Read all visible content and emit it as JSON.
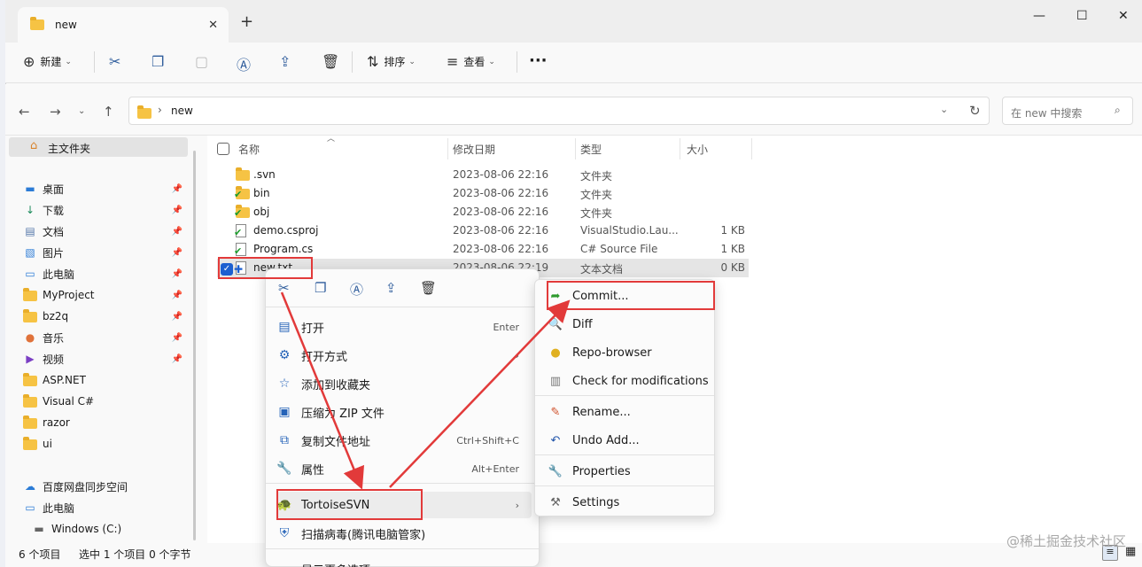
{
  "tab": {
    "title": "new",
    "close": "✕",
    "new": "+"
  },
  "window_controls": {
    "minimize": "—",
    "maximize": "☐",
    "close": "✕"
  },
  "toolbar": {
    "new_label": "新建",
    "sort_label": "排序",
    "view_label": "查看",
    "more": "···"
  },
  "address": {
    "folder": "new",
    "sep": "›",
    "search_placeholder": "在 new 中搜索"
  },
  "sidebar": {
    "home": "主文件夹",
    "items": [
      {
        "label": "桌面",
        "icon": "desktop-icon",
        "pinned": true
      },
      {
        "label": "下载",
        "icon": "download-icon",
        "pinned": true
      },
      {
        "label": "文档",
        "icon": "document-icon",
        "pinned": true
      },
      {
        "label": "图片",
        "icon": "picture-icon",
        "pinned": true
      },
      {
        "label": "此电脑",
        "icon": "computer-icon",
        "pinned": true
      },
      {
        "label": "MyProject",
        "icon": "folder-icon",
        "pinned": true
      },
      {
        "label": "bz2q",
        "icon": "folder-icon",
        "pinned": true
      },
      {
        "label": "音乐",
        "icon": "music-icon",
        "pinned": true
      },
      {
        "label": "视频",
        "icon": "video-icon",
        "pinned": true
      },
      {
        "label": "ASP.NET",
        "icon": "folder-icon",
        "pinned": false
      },
      {
        "label": "Visual C#",
        "icon": "folder-icon",
        "pinned": false
      },
      {
        "label": "razor",
        "icon": "folder-icon",
        "pinned": false
      },
      {
        "label": "ui",
        "icon": "folder-icon",
        "pinned": false
      }
    ],
    "bottom": [
      {
        "label": "百度网盘同步空间",
        "icon": "cloud-icon"
      },
      {
        "label": "此电脑",
        "icon": "computer-icon"
      },
      {
        "label": "Windows (C:)",
        "icon": "drive-icon"
      }
    ]
  },
  "columns": {
    "name": "名称",
    "date": "修改日期",
    "type": "类型",
    "size": "大小"
  },
  "files": [
    {
      "name": ".svn",
      "date": "2023-08-06 22:16",
      "type": "文件夹",
      "size": "",
      "icon": "folder-icon"
    },
    {
      "name": "bin",
      "date": "2023-08-06 22:16",
      "type": "文件夹",
      "size": "",
      "icon": "svn-folder-icon"
    },
    {
      "name": "obj",
      "date": "2023-08-06 22:16",
      "type": "文件夹",
      "size": "",
      "icon": "svn-folder-icon"
    },
    {
      "name": "demo.csproj",
      "date": "2023-08-06 22:16",
      "type": "VisualStudio.Lau...",
      "size": "1 KB",
      "icon": "svn-file-icon"
    },
    {
      "name": "Program.cs",
      "date": "2023-08-06 22:16",
      "type": "C# Source File",
      "size": "1 KB",
      "icon": "svn-file-icon"
    },
    {
      "name": "new.txt",
      "date": "2023-08-06 22:19",
      "type": "文本文档",
      "size": "0 KB",
      "icon": "svn-added-icon",
      "selected": true
    }
  ],
  "context_menu": {
    "items": [
      {
        "label": "打开",
        "shortcut": "Enter",
        "icon": "open-icon"
      },
      {
        "label": "打开方式",
        "shortcut": "›",
        "icon": "open-with-icon"
      },
      {
        "label": "添加到收藏夹",
        "shortcut": "",
        "icon": "star-icon"
      },
      {
        "label": "压缩为 ZIP 文件",
        "shortcut": "",
        "icon": "zip-icon"
      },
      {
        "label": "复制文件地址",
        "shortcut": "Ctrl+Shift+C",
        "icon": "copy-path-icon"
      },
      {
        "label": "属性",
        "shortcut": "Alt+Enter",
        "icon": "wrench-icon"
      },
      {
        "label": "TortoiseSVN",
        "shortcut": "›",
        "icon": "tortoise-icon"
      },
      {
        "label": "扫描病毒(腾讯电脑管家)",
        "shortcut": "",
        "icon": "shield-icon"
      },
      {
        "label": "显示更多选项",
        "shortcut": "",
        "icon": "more-options-icon"
      }
    ]
  },
  "svn_menu": {
    "items": [
      {
        "label": "Commit...",
        "icon": "commit-icon"
      },
      {
        "label": "Diff",
        "icon": "diff-icon"
      },
      {
        "label": "Repo-browser",
        "icon": "repo-browser-icon"
      },
      {
        "label": "Check for modifications",
        "icon": "check-mods-icon"
      },
      {
        "label": "Rename...",
        "icon": "rename-icon"
      },
      {
        "label": "Undo Add...",
        "icon": "undo-icon"
      },
      {
        "label": "Properties",
        "icon": "properties-icon"
      },
      {
        "label": "Settings",
        "icon": "settings-icon"
      }
    ]
  },
  "status": {
    "count": "6 个项目",
    "selection": "选中 1 个项目  0 个字节"
  },
  "watermark": "@稀土掘金技术社区"
}
